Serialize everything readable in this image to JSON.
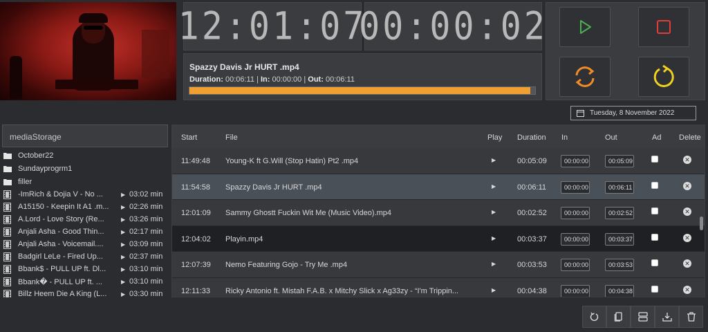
{
  "clocks": {
    "time": "12:01:07",
    "countdown": "00:00:02"
  },
  "now_playing": {
    "title": "Spazzy Davis Jr HURT .mp4",
    "duration_label": "Duration:",
    "duration": "00:06:11",
    "in_label": "In:",
    "in": "00:00:00",
    "out_label": "Out:",
    "out": "00:06:11",
    "progress": 0.985,
    "progress_color": "#f0a030"
  },
  "controls": {
    "play_icon": "play-icon",
    "stop_icon": "stop-icon",
    "refresh_icon": "refresh-icon",
    "reload_icon": "reload-icon",
    "colors": {
      "play": "#4caf50",
      "stop": "#e03c3c",
      "refresh": "#f08c28",
      "reload": "#f0d020"
    }
  },
  "date": "Tuesday, 8 November 2022",
  "media": {
    "placeholder": "mediaStorage",
    "items": [
      {
        "type": "folder",
        "name": "October22"
      },
      {
        "type": "folder",
        "name": "Sundayprogrm1"
      },
      {
        "type": "folder",
        "name": "filler"
      },
      {
        "type": "file",
        "name": "-ImRich & Dojia V - No ...",
        "duration": "03:02 min"
      },
      {
        "type": "file",
        "name": "A15150 - Keepin It A1 .m...",
        "duration": "02:26 min"
      },
      {
        "type": "file",
        "name": "A.Lord - Love Story (Re...",
        "duration": "03:26 min"
      },
      {
        "type": "file",
        "name": "Anjali Asha - Good Thin...",
        "duration": "02:17 min"
      },
      {
        "type": "file",
        "name": "Anjali Asha - Voicemail....",
        "duration": "03:09 min"
      },
      {
        "type": "file",
        "name": "Badgirl LeLe - Fired Up...",
        "duration": "02:37 min"
      },
      {
        "type": "file",
        "name": "Bbank$ - PULL UP ft. Dl...",
        "duration": "03:10 min"
      },
      {
        "type": "file",
        "name": "Bbank� - PULL UP ft. ...",
        "duration": "03:10 min"
      },
      {
        "type": "file",
        "name": "Billz Heem Die A King (L...",
        "duration": "03:30 min"
      }
    ]
  },
  "playlist": {
    "columns": {
      "start": "Start",
      "file": "File",
      "play": "Play",
      "duration": "Duration",
      "in": "In",
      "out": "Out",
      "ad": "Ad",
      "delete": "Delete"
    },
    "rows": [
      {
        "start": "11:49:48",
        "file": "Young-K ft G.Will (Stop Hatin) Pt2 .mp4",
        "duration": "00:05:09",
        "in": "00:00:00",
        "out": "00:05:09",
        "state": "normal"
      },
      {
        "start": "11:54:58",
        "file": "Spazzy Davis Jr HURT .mp4",
        "duration": "00:06:11",
        "in": "00:00:00",
        "out": "00:06:11",
        "state": "current"
      },
      {
        "start": "12:01:09",
        "file": "Sammy Ghostt Fuckin Wit Me (Music Video).mp4",
        "duration": "00:02:52",
        "in": "00:00:00",
        "out": "00:02:52",
        "state": "normal"
      },
      {
        "start": "12:04:02",
        "file": "Playin.mp4",
        "duration": "00:03:37",
        "in": "00:00:00",
        "out": "00:03:37",
        "state": "dark"
      },
      {
        "start": "12:07:39",
        "file": "Nemo Featuring Gojo - Try Me .mp4",
        "duration": "00:03:53",
        "in": "00:00:00",
        "out": "00:03:53",
        "state": "normal"
      },
      {
        "start": "12:11:33",
        "file": "Ricky Antonio ft. Mistah F.A.B. x Mitchy Slick x Ag33zy - “I'm Trippin...",
        "duration": "00:04:38",
        "in": "00:00:00",
        "out": "00:04:38",
        "state": "normal"
      }
    ]
  },
  "toolbar": [
    "reset-icon",
    "copy-icon",
    "split-icon",
    "download-icon",
    "trash-icon"
  ]
}
